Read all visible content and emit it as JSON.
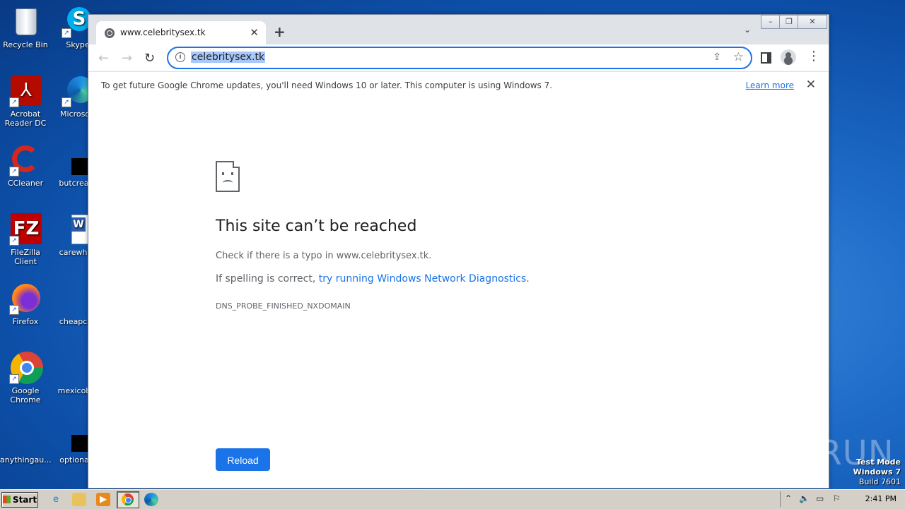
{
  "desktop": {
    "icons": [
      {
        "label": "Recycle Bin",
        "name": "recycle-bin-icon"
      },
      {
        "label": "Skype",
        "name": "skype-icon"
      },
      {
        "label": "Acrobat Reader DC",
        "name": "acrobat-icon"
      },
      {
        "label": "Microsoft",
        "name": "edge-icon"
      },
      {
        "label": "CCleaner",
        "name": "ccleaner-icon"
      },
      {
        "label": "butcreate",
        "name": "file-icon"
      },
      {
        "label": "FileZilla Client",
        "name": "filezilla-icon"
      },
      {
        "label": "carewhile",
        "name": "word-doc-icon"
      },
      {
        "label": "Firefox",
        "name": "firefox-icon"
      },
      {
        "label": "cheapcall",
        "name": "file-icon"
      },
      {
        "label": "Google Chrome",
        "name": "chrome-icon"
      },
      {
        "label": "mexicobig",
        "name": "file-icon"
      },
      {
        "label": "anythingau...",
        "name": "file-icon"
      },
      {
        "label": "optionald",
        "name": "file-icon"
      }
    ]
  },
  "browser": {
    "tab_title": "www.celebritysex.tk",
    "new_tab_symbol": "+",
    "url": "celebritysex.tk",
    "infobar": {
      "message": "To get future Google Chrome updates, you'll need Windows 10 or later. This computer is using Windows 7.",
      "link": "Learn more"
    },
    "error": {
      "title": "This site can’t be reached",
      "check_text": "Check if there is a typo in www.celebritysex.tk.",
      "spell_prefix": "If spelling is correct, ",
      "spell_link": "try running Windows Network Diagnostics",
      "spell_suffix": ".",
      "code": "DNS_PROBE_FINISHED_NXDOMAIN",
      "reload_label": "Reload"
    }
  },
  "watermark": "ANY RUN",
  "os_badge": {
    "line1": "Test Mode",
    "line2": "Windows 7",
    "line3": "Build 7601"
  },
  "taskbar": {
    "start_label": "Start",
    "clock": "2:41 PM"
  }
}
